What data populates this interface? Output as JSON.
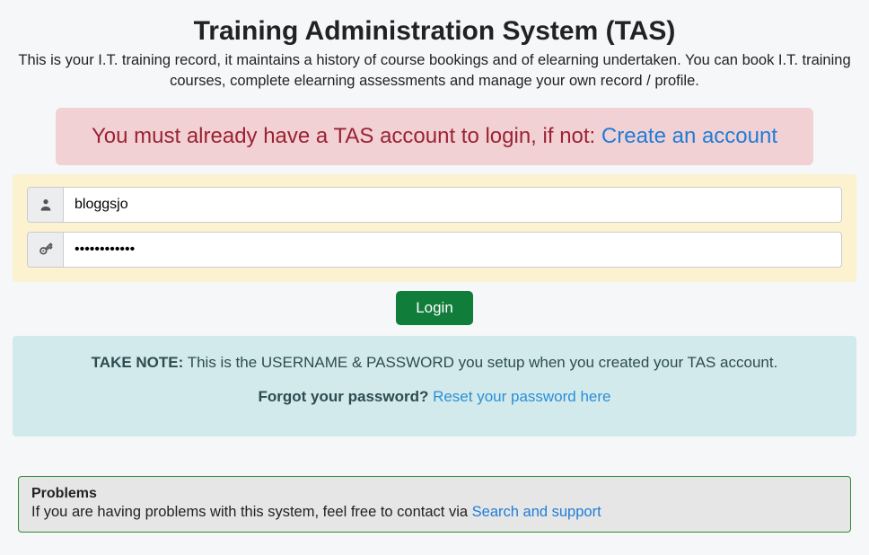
{
  "header": {
    "title": "Training Administration System (TAS)",
    "description": "This is your I.T. training record, it maintains a history of course bookings and of elearning undertaken. You can book I.T. training courses, complete elearning assessments and manage your own record / profile."
  },
  "alert": {
    "prefix": "You must already have a TAS account to login, if not: ",
    "link_text": "Create an account"
  },
  "login": {
    "username_value": "bloggsjo",
    "username_placeholder": "",
    "password_value": "••••••••••••",
    "password_placeholder": "",
    "button_label": "Login"
  },
  "note": {
    "take_note_label": "TAKE NOTE:",
    "take_note_text": " This is the USERNAME & PASSWORD you setup when you created your TAS account.",
    "forgot_label": "Forgot your password? ",
    "forgot_link": "Reset your password here"
  },
  "problems": {
    "title": "Problems",
    "text_prefix": "If you are having problems with this system, feel free to contact via ",
    "link_text": "Search and support"
  }
}
